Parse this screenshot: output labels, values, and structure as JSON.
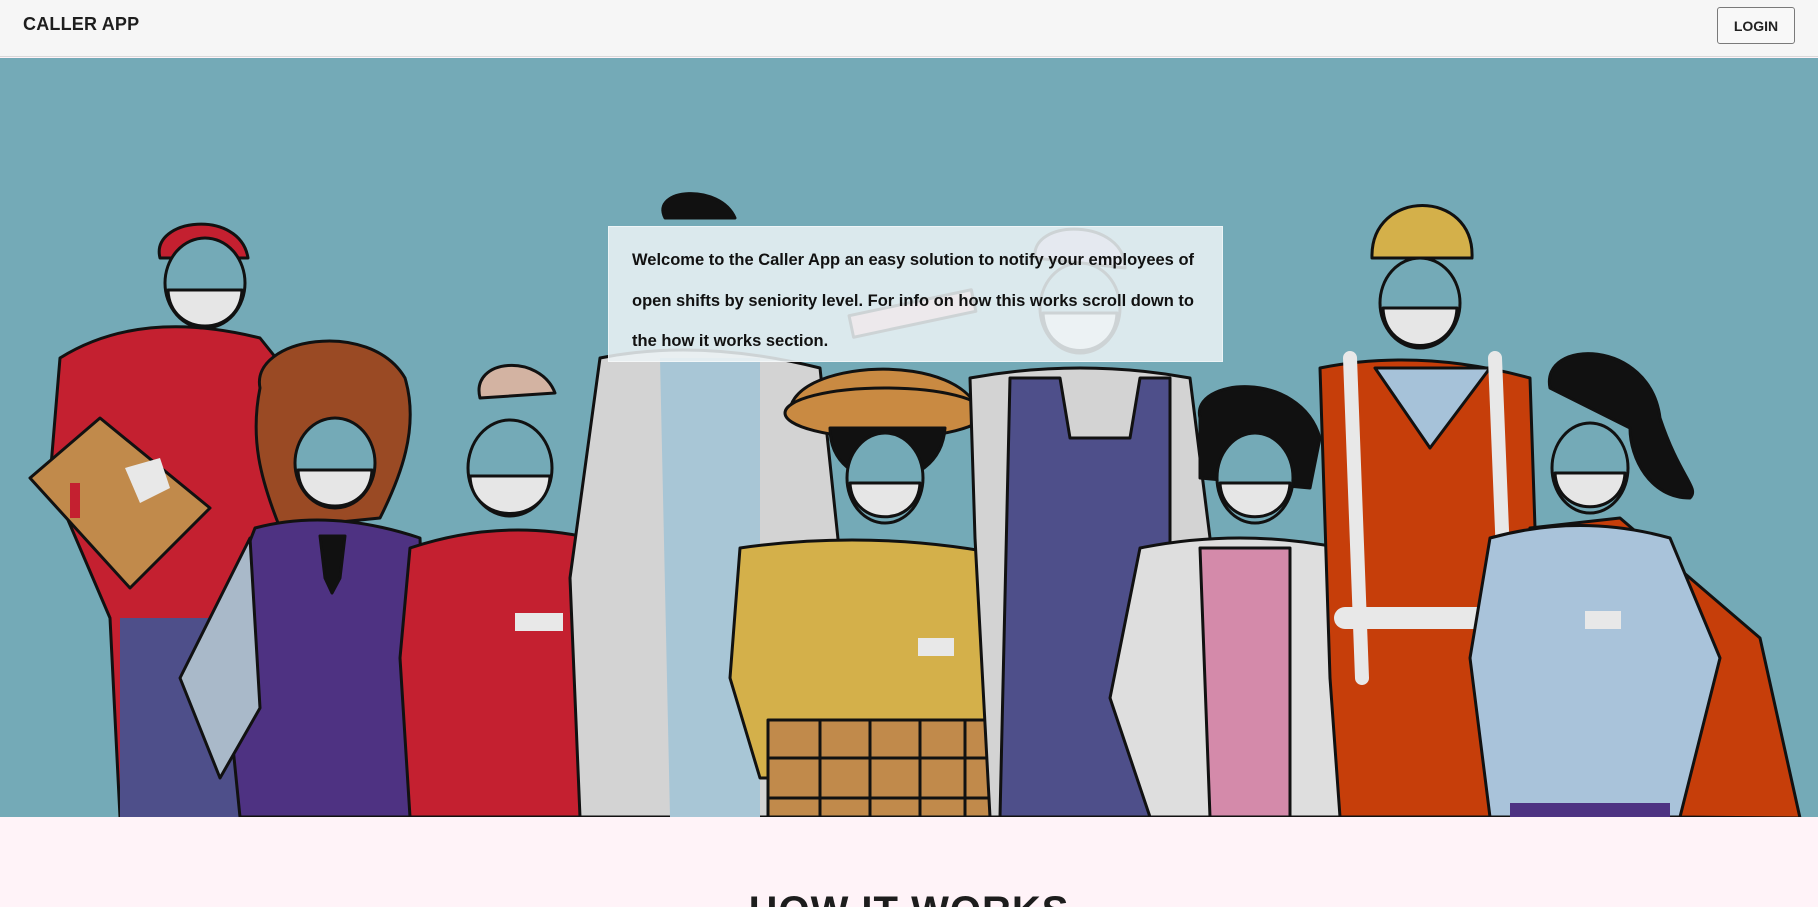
{
  "navbar": {
    "brand": "CALLER APP",
    "login_label": "LOGIN"
  },
  "hero": {
    "welcome_text": "Welcome to the Caller App an easy solution to notify your employees of open shifts by seniority level. For info on how this works scroll down to the how it works section."
  },
  "how_it_works": {
    "title": "HOW IT WORKS"
  },
  "colors": {
    "navbar_bg": "#f6f6f6",
    "hero_bg": "#74aab7",
    "section_bg": "#fff3f8",
    "accent_red": "#c42030"
  }
}
